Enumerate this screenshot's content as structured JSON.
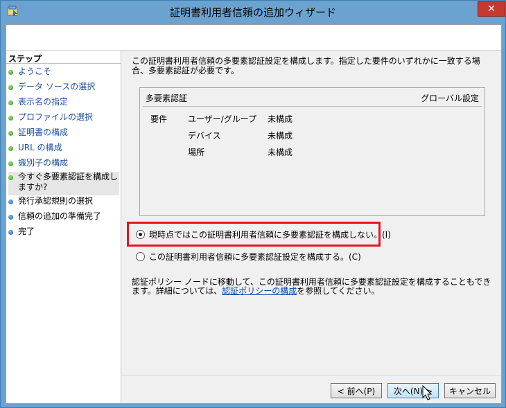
{
  "window": {
    "title": "証明書利用者信頼の追加ウィザード",
    "close_glyph": "✕"
  },
  "steps": {
    "header": "ステップ",
    "items": [
      {
        "label": "ようこそ",
        "state": "done"
      },
      {
        "label": "データ ソースの選択",
        "state": "done"
      },
      {
        "label": "表示名の指定",
        "state": "done"
      },
      {
        "label": "プロファイルの選択",
        "state": "done"
      },
      {
        "label": "証明書の構成",
        "state": "done"
      },
      {
        "label": "URL の構成",
        "state": "done"
      },
      {
        "label": "識別子の構成",
        "state": "done"
      },
      {
        "label": "今すぐ多要素認証を構成しますか?",
        "state": "current"
      },
      {
        "label": "発行承認規則の選択",
        "state": "pending"
      },
      {
        "label": "信頼の追加の準備完了",
        "state": "pending"
      },
      {
        "label": "完了",
        "state": "pending"
      }
    ]
  },
  "main": {
    "intro": "この証明書利用者信頼の多要素認証設定を構成します。指定した要件のいずれかに一致する場合、多要素認証が必要です。",
    "mfa": {
      "header_left": "多要素認証",
      "header_right": "グローバル設定",
      "req_label": "要件",
      "rows": [
        {
          "name": "ユーザー/グループ",
          "value": "未構成"
        },
        {
          "name": "デバイス",
          "value": "未構成"
        },
        {
          "name": "場所",
          "value": "未構成"
        }
      ]
    },
    "options": {
      "no_configure": "現時点ではこの証明書利用者信頼に多要素認証を構成しない。(I)",
      "configure": "この証明書利用者信頼に多要素認証設定を構成する。(C)"
    },
    "note_pre": "認証ポリシー ノードに移動して、この証明書利用者信頼に多要素認証設定を構成することもできます。詳細については、",
    "note_link": "認証ポリシーの構成",
    "note_post": "を参照してください。"
  },
  "buttons": {
    "back": "< 前へ(P)",
    "next": "次へ(N) >",
    "cancel": "キャンセル"
  },
  "colors": {
    "highlight": "#e8141d",
    "titlebar": "#6ba2d0",
    "close": "#c7382f"
  }
}
